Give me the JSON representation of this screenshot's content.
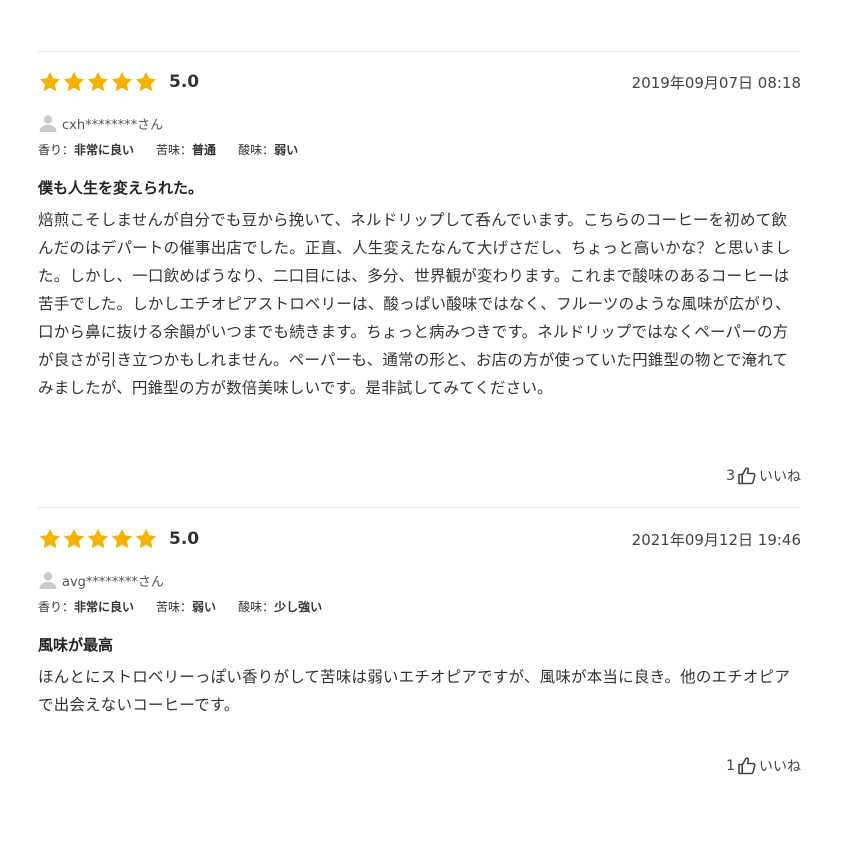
{
  "reviews": [
    {
      "score": "5.0",
      "rating": 5,
      "date": "2019年09月07日 08:18",
      "user": "cxh********さん",
      "attrs": [
        {
          "key": "香り：",
          "value": "非常に良い"
        },
        {
          "key": "苦味：",
          "value": "普通"
        },
        {
          "key": "酸味：",
          "value": "弱い"
        }
      ],
      "title": "僕も人生を変えられた。",
      "body": "焙煎こそしませんが自分でも豆から挽いて、ネルドリップして呑んでいます。こちらのコーヒーを初めて飲んだのはデパートの催事出店でした。正直、人生変えたなんて大げさだし、ちょっと高いかな？と思いました。しかし、一口飲めばうなり、二口目には、多分、世界観が変わります。これまで酸味のあるコーヒーは苦手でした。しかしエチオピアストロベリーは、酸っぱい酸味ではなく、フルーツのような風味が広がり、口から鼻に抜ける余韻がいつまでも続きます。ちょっと病みつきです。ネルドリップではなくペーパーの方が良さが引き立つかもしれません。ペーパーも、通常の形と、お店の方が使っていた円錐型の物とで淹れてみましたが、円錐型の方が数倍美味しいです。是非試してみてください。",
      "likes": "3",
      "like_label": "いいね"
    },
    {
      "score": "5.0",
      "rating": 5,
      "date": "2021年09月12日 19:46",
      "user": "avg********さん",
      "attrs": [
        {
          "key": "香り：",
          "value": "非常に良い"
        },
        {
          "key": "苦味：",
          "value": "弱い"
        },
        {
          "key": "酸味：",
          "value": "少し強い"
        }
      ],
      "title": "風味が最高",
      "body": "ほんとにストロベリーっぽい香りがして苦味は弱いエチオピアですが、風味が本当に良き。他のエチオピアで出会えないコーヒーです。",
      "likes": "1",
      "like_label": "いいね"
    }
  ],
  "colors": {
    "star": "#f5b301",
    "divider": "#e8e8e8",
    "icon": "#bbbbbb"
  },
  "icons": {
    "star": "star-icon",
    "user": "user-icon",
    "like": "thumbs-up-icon"
  }
}
